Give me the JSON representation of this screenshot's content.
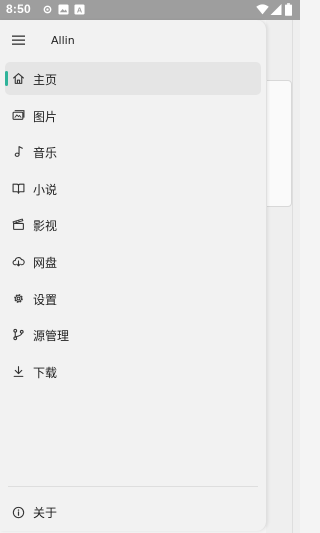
{
  "status_bar": {
    "time": "8:50",
    "left_icons": [
      "gear-icon",
      "image-icon",
      "app-a-icon"
    ],
    "right_icons": [
      "wifi-icon",
      "signal-icon",
      "battery-icon"
    ],
    "app_icon_letter": "A"
  },
  "drawer": {
    "title": "Allin",
    "menu_icon": "hamburger-menu-icon",
    "items": [
      {
        "label": "主页",
        "icon": "home-icon",
        "active": true
      },
      {
        "label": "图片",
        "icon": "gallery-icon",
        "active": false
      },
      {
        "label": "音乐",
        "icon": "music-note-icon",
        "active": false
      },
      {
        "label": "小说",
        "icon": "book-icon",
        "active": false
      },
      {
        "label": "影视",
        "icon": "clapperboard-icon",
        "active": false
      },
      {
        "label": "网盘",
        "icon": "cloud-download-icon",
        "active": false
      },
      {
        "label": "设置",
        "icon": "settings-gear-icon",
        "active": false
      },
      {
        "label": "源管理",
        "icon": "source-branch-icon",
        "active": false
      },
      {
        "label": "下载",
        "icon": "download-icon",
        "active": false
      }
    ],
    "about": {
      "label": "关于",
      "icon": "info-icon"
    }
  },
  "colors": {
    "accent": "#2fb39a",
    "drawer_bg": "#f2f2f2",
    "active_bg": "#e5e5e5",
    "status_bar": "#9e9e9e"
  }
}
